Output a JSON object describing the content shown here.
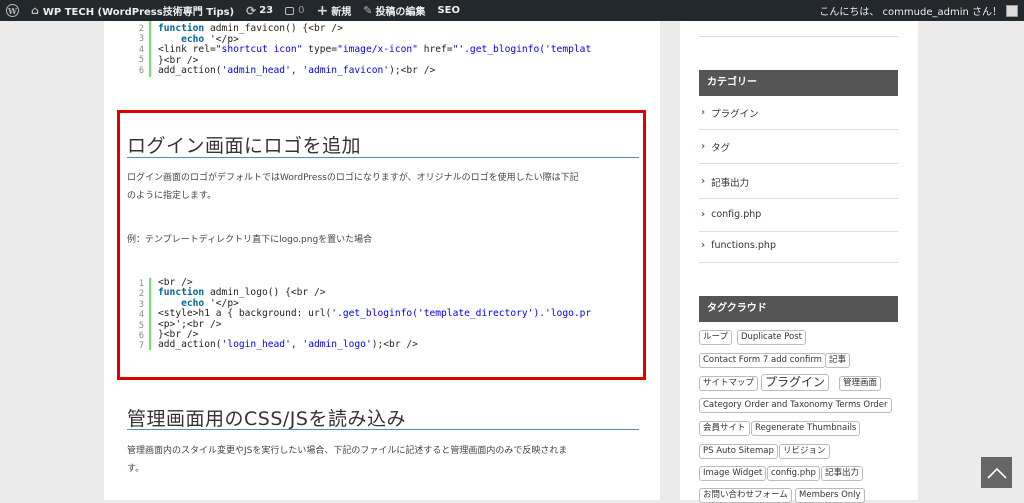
{
  "adminbar": {
    "site_name": "WP TECH (WordPress技術専門 Tips)",
    "updates_count": "23",
    "comments_count": "0",
    "new_label": "新規",
    "edit_label": "投稿の編集",
    "seo_label": "SEO",
    "greeting": "こんにちは、 commude_admin さん！"
  },
  "code_top": {
    "numbers": [
      "2",
      "3",
      "4",
      "5",
      "6"
    ]
  },
  "section1": {
    "title": "ログイン画面にロゴを追加",
    "para1_line1": "ログイン画面のロゴがデフォルトではWordPressのロゴになりますが、オリジナルのロゴを使用したい際は下記",
    "para1_line2": "のように指定します。",
    "para2": "例：テンプレートディレクトリ直下にlogo.pngを置いた場合"
  },
  "code_login": {
    "numbers": [
      "1",
      "2",
      "3",
      "4",
      "5",
      "6",
      "7"
    ]
  },
  "section2": {
    "title": "管理画面用のCSS/JSを読み込み",
    "para_line1": "管理画面内のスタイル変更やJSを実行したい場合、下記のファイルに記述すると管理画面内のみで反映されま",
    "para_line2": "す。"
  },
  "sidebar": {
    "categories_title": "カテゴリー",
    "categories": [
      "プラグイン",
      "タグ",
      "記事出力",
      "config.php",
      "functions.php"
    ],
    "tagcloud_title": "タグクラウド",
    "tags": [
      "ループ",
      "Duplicate Post",
      "Contact Form 7 add confirm",
      "記事",
      "サイトマップ",
      "プラグイン",
      "管理画面",
      "Category Order and Taxonomy Terms Order",
      "会員サイト",
      "Regenerate Thumbnails",
      "PS Auto Sitemap",
      "リビジョン",
      "Image Widget",
      "config.php",
      "記事出力",
      "お問い合わせフォーム",
      "Members Only"
    ]
  },
  "colors": {
    "adminbar_bg": "#23282d",
    "highlight_border": "#e00000",
    "code_gutter_bar": "#6ce26c",
    "keyword": "#006699",
    "string": "#0000ff",
    "sidebar_header_bg": "#555555",
    "link_chevron": "#1e73be"
  }
}
